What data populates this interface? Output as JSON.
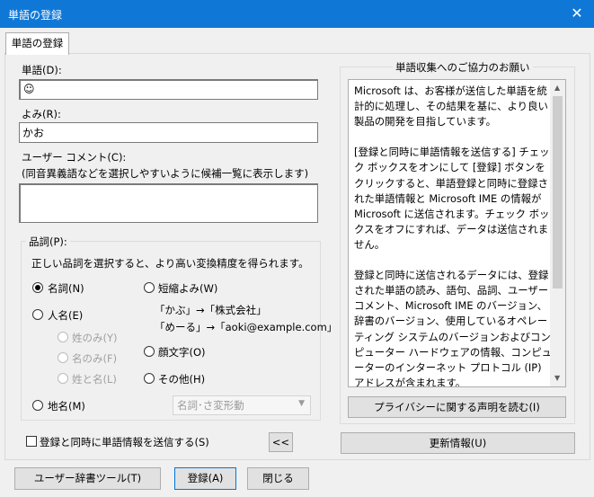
{
  "window": {
    "title": "単語の登録",
    "close_glyph": "✕"
  },
  "tab": {
    "label": "単語の登録"
  },
  "word": {
    "label": "単語(D):",
    "value": "☺"
  },
  "yomi": {
    "label": "よみ(R):",
    "value": "かお"
  },
  "comment": {
    "label": "ユーザー コメント(C):",
    "hint": "(同音異義語などを選択しやすいように候補一覧に表示します)",
    "value": ""
  },
  "pos": {
    "legend": "品詞(P):",
    "description": "正しい品詞を選択すると、より高い変換精度を得られます。",
    "options": {
      "meishi": "名詞(N)",
      "jinmei": "人名(E)",
      "sei_nomi": "姓のみ(Y)",
      "mei_nomi": "名のみ(F)",
      "sei_to_mei": "姓と名(L)",
      "chimei": "地名(M)",
      "tanshuku": "短縮よみ(W)",
      "kaomoji": "顔文字(O)",
      "sonota": "その他(H)"
    },
    "examples": [
      "「かぶ」→「株式会社」",
      "「めーる」→「aoki@example.com」"
    ],
    "selected": "meishi",
    "subtype": "名詞･さ変形動"
  },
  "send_checkbox": {
    "label": "登録と同時に単語情報を送信する(S)",
    "checked": false
  },
  "collapse_button": {
    "label": "<<"
  },
  "info": {
    "legend": "単語収集へのご協力のお願い",
    "text": "Microsoft は、お客様が送信した単語を統計的に処理し、その結果を基に、より良い製品の開発を目指しています。\n\n[登録と同時に単語情報を送信する] チェック ボックスをオンにして [登録] ボタンをクリックすると、単語登録と同時に登録された単語情報と Microsoft IME の情報が Microsoft に送信されます。チェック ボックスをオフにすれば、データは送信されません。\n\n登録と同時に送信されるデータには、登録された単語の読み、語句、品詞、ユーザー コメント、Microsoft IME のバージョン、辞書のバージョン、使用しているオペレーティング システムのバージョンおよびコンピューター ハードウェアの情報、コンピューターのインターネット プロトコル (IP) アドレスが含まれます。\n\nお客様特有の情報が収集されたデータに含まれることがあります。このような情報が存在する場合でも、Microsoft では、お客様を特定するために使用することはありません。",
    "privacy_button": "プライバシーに関する声明を読む(I)",
    "update_button": "更新情報(U)"
  },
  "footer": {
    "dict_tool": "ユーザー辞書ツール(T)",
    "register": "登録(A)",
    "close": "閉じる"
  }
}
